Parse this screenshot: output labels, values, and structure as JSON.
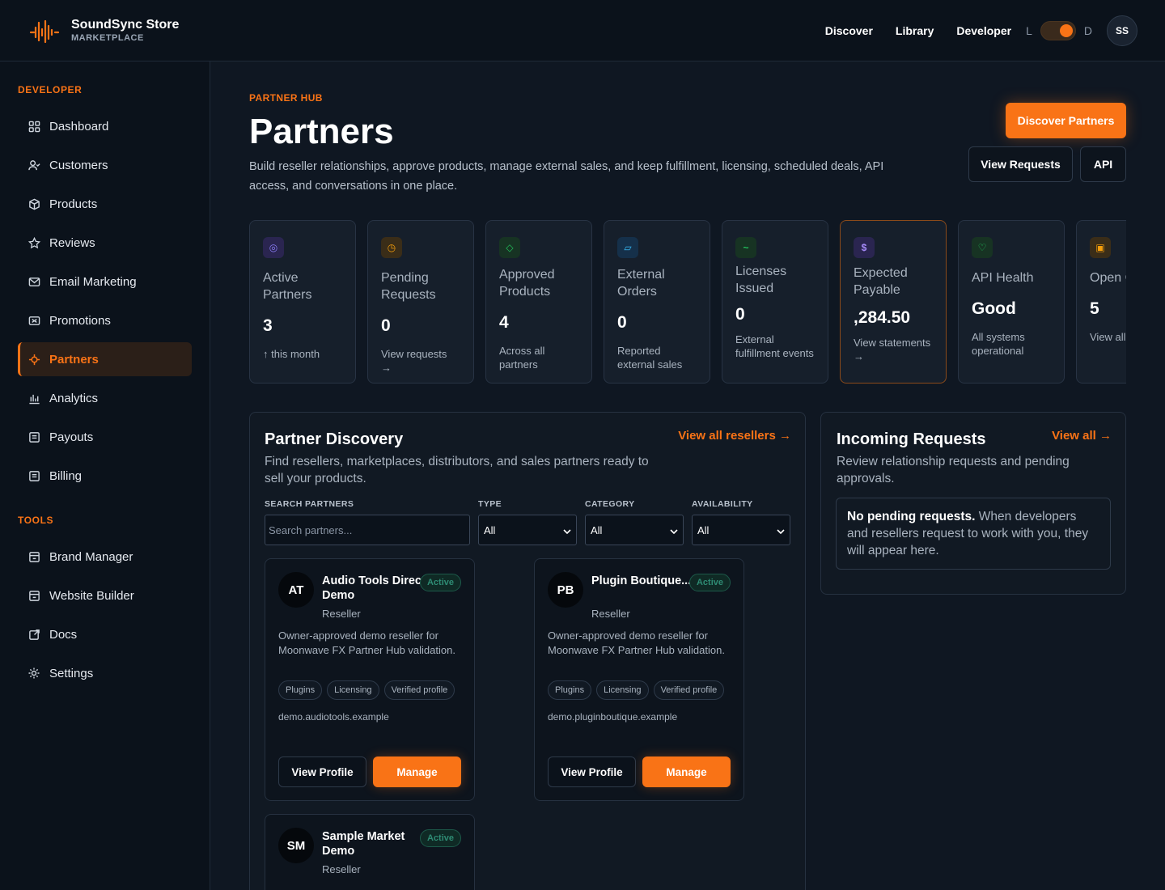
{
  "header": {
    "brand_name": "SoundSync Store",
    "brand_sub": "MARKETPLACE",
    "nav": [
      "Discover",
      "Library",
      "Developer"
    ],
    "theme_light": "L",
    "theme_dark": "D",
    "avatar_initials": "SS",
    "accent_color": "#f97316"
  },
  "sidebar": {
    "section_developer": "DEVELOPER",
    "developer_items": [
      {
        "label": "Dashboard",
        "icon": "grid-icon"
      },
      {
        "label": "Customers",
        "icon": "user-icon"
      },
      {
        "label": "Products",
        "icon": "box-icon"
      },
      {
        "label": "Reviews",
        "icon": "star-icon"
      },
      {
        "label": "Email Marketing",
        "icon": "mail-icon"
      },
      {
        "label": "Promotions",
        "icon": "ticket-icon"
      },
      {
        "label": "Partners",
        "icon": "partner-icon",
        "active": true
      },
      {
        "label": "Analytics",
        "icon": "bar-chart-icon"
      },
      {
        "label": "Payouts",
        "icon": "receipt-icon"
      },
      {
        "label": "Billing",
        "icon": "receipt-icon"
      }
    ],
    "section_tools": "TOOLS",
    "tools_items": [
      {
        "label": "Brand Manager",
        "icon": "store-icon"
      },
      {
        "label": "Website Builder",
        "icon": "store-icon"
      },
      {
        "label": "Docs",
        "icon": "external-link-icon"
      },
      {
        "label": "Settings",
        "icon": "gear-icon"
      }
    ]
  },
  "page": {
    "eyebrow": "PARTNER HUB",
    "title": "Partners",
    "description": "Build reseller relationships, approve products, manage external sales, and keep fulfillment, licensing, scheduled deals, API access, and conversations in one place.",
    "btn_discover": "Discover Partners",
    "btn_requests": "View Requests",
    "btn_api": "API"
  },
  "stats": [
    {
      "label": "Active Partners",
      "value": "3",
      "foot": "↑ this month",
      "icon": "target-icon",
      "icon_color": "#8b7cf6"
    },
    {
      "label": "Pending Requests",
      "value": "0",
      "foot": "View requests →",
      "icon": "clock-icon",
      "icon_color": "#f59e0b"
    },
    {
      "label": "Approved Products",
      "value": "4",
      "foot": "Across all partners",
      "icon": "diamond-icon",
      "icon_color": "#22c55e"
    },
    {
      "label": "External Orders",
      "value": "0",
      "foot": "Reported external sales",
      "icon": "card-icon",
      "icon_color": "#38bdf8"
    },
    {
      "label": "Licenses Issued",
      "value": "0",
      "foot": "External fulfillment events",
      "icon": "key-icon",
      "icon_color": "#22c55e"
    },
    {
      "label": "Expected Payable",
      "value": ",284.50",
      "foot": "View statements →",
      "icon": "dollar-icon",
      "icon_color": "#a78bfa"
    },
    {
      "label": "API Health",
      "value": "Good",
      "foot": "All systems operational",
      "icon": "heart-icon",
      "icon_color": "#22c55e"
    },
    {
      "label": "Open Conve",
      "value": "5",
      "foot": "View all",
      "icon": "chat-icon",
      "icon_color": "#f59e0b"
    }
  ],
  "discovery": {
    "title": "Partner Discovery",
    "link": "View all resellers →",
    "description": "Find resellers, marketplaces, distributors, and sales partners ready to sell your products.",
    "search_label": "SEARCH PARTNERS",
    "search_placeholder": "Search partners...",
    "type_label": "TYPE",
    "type_value": "All",
    "category_label": "CATEGORY",
    "category_value": "All",
    "availability_label": "AVAILABILITY",
    "availability_value": "All",
    "partners": [
      {
        "initials": "AT",
        "name": "Audio Tools Direct Demo",
        "type": "Reseller",
        "status": "Active",
        "desc": "Owner-approved demo reseller for Moonwave FX Partner Hub validation.",
        "tags": [
          "Plugins",
          "Licensing",
          "Verified profile"
        ],
        "domain": "demo.audiotools.example",
        "view": "View Profile",
        "manage": "Manage"
      },
      {
        "initials": "PB",
        "name": "Plugin Boutique...",
        "type": "Reseller",
        "status": "Active",
        "desc": "Owner-approved demo reseller for Moonwave FX Partner Hub validation.",
        "tags": [
          "Plugins",
          "Licensing",
          "Verified profile"
        ],
        "domain": "demo.pluginboutique.example",
        "view": "View Profile",
        "manage": "Manage"
      },
      {
        "initials": "SM",
        "name": "Sample Market Demo",
        "type": "Reseller",
        "status": "Active"
      }
    ]
  },
  "incoming": {
    "title": "Incoming Requests",
    "link": "View all →",
    "description": "Review relationship requests and pending approvals.",
    "empty_bold": "No pending requests.",
    "empty_text": " When developers and resellers request to work with you, they will appear here."
  }
}
